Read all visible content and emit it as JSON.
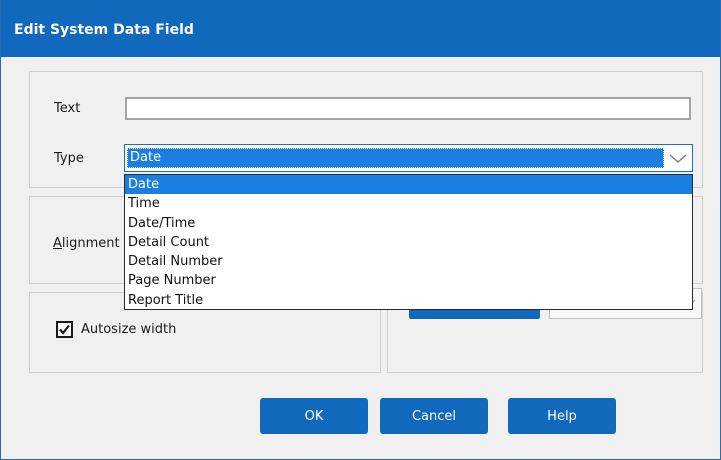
{
  "dialog": {
    "title": "Edit System Data Field"
  },
  "form": {
    "text_label": "Text",
    "text_value": "",
    "type_label": "Type",
    "type_value": "Date",
    "alignment_label_prefix": "A",
    "alignment_label_rest": "lignment",
    "autosize_label": "Autosize width",
    "autosize_checked": true
  },
  "type_dropdown": {
    "options": [
      "Date",
      "Time",
      "Date/Time",
      "Detail Count",
      "Detail Number",
      "Page Number",
      "Report Title"
    ],
    "highlighted": "Date"
  },
  "buttons": {
    "ok": "OK",
    "cancel": "Cancel",
    "help": "Help"
  },
  "colors": {
    "titlebar": "#1169bd",
    "button": "#1169bd",
    "selection": "#1a7fe0"
  },
  "icons": {
    "type_chevron": "chevron-down-icon",
    "autosize_check": "checkmark-icon"
  }
}
